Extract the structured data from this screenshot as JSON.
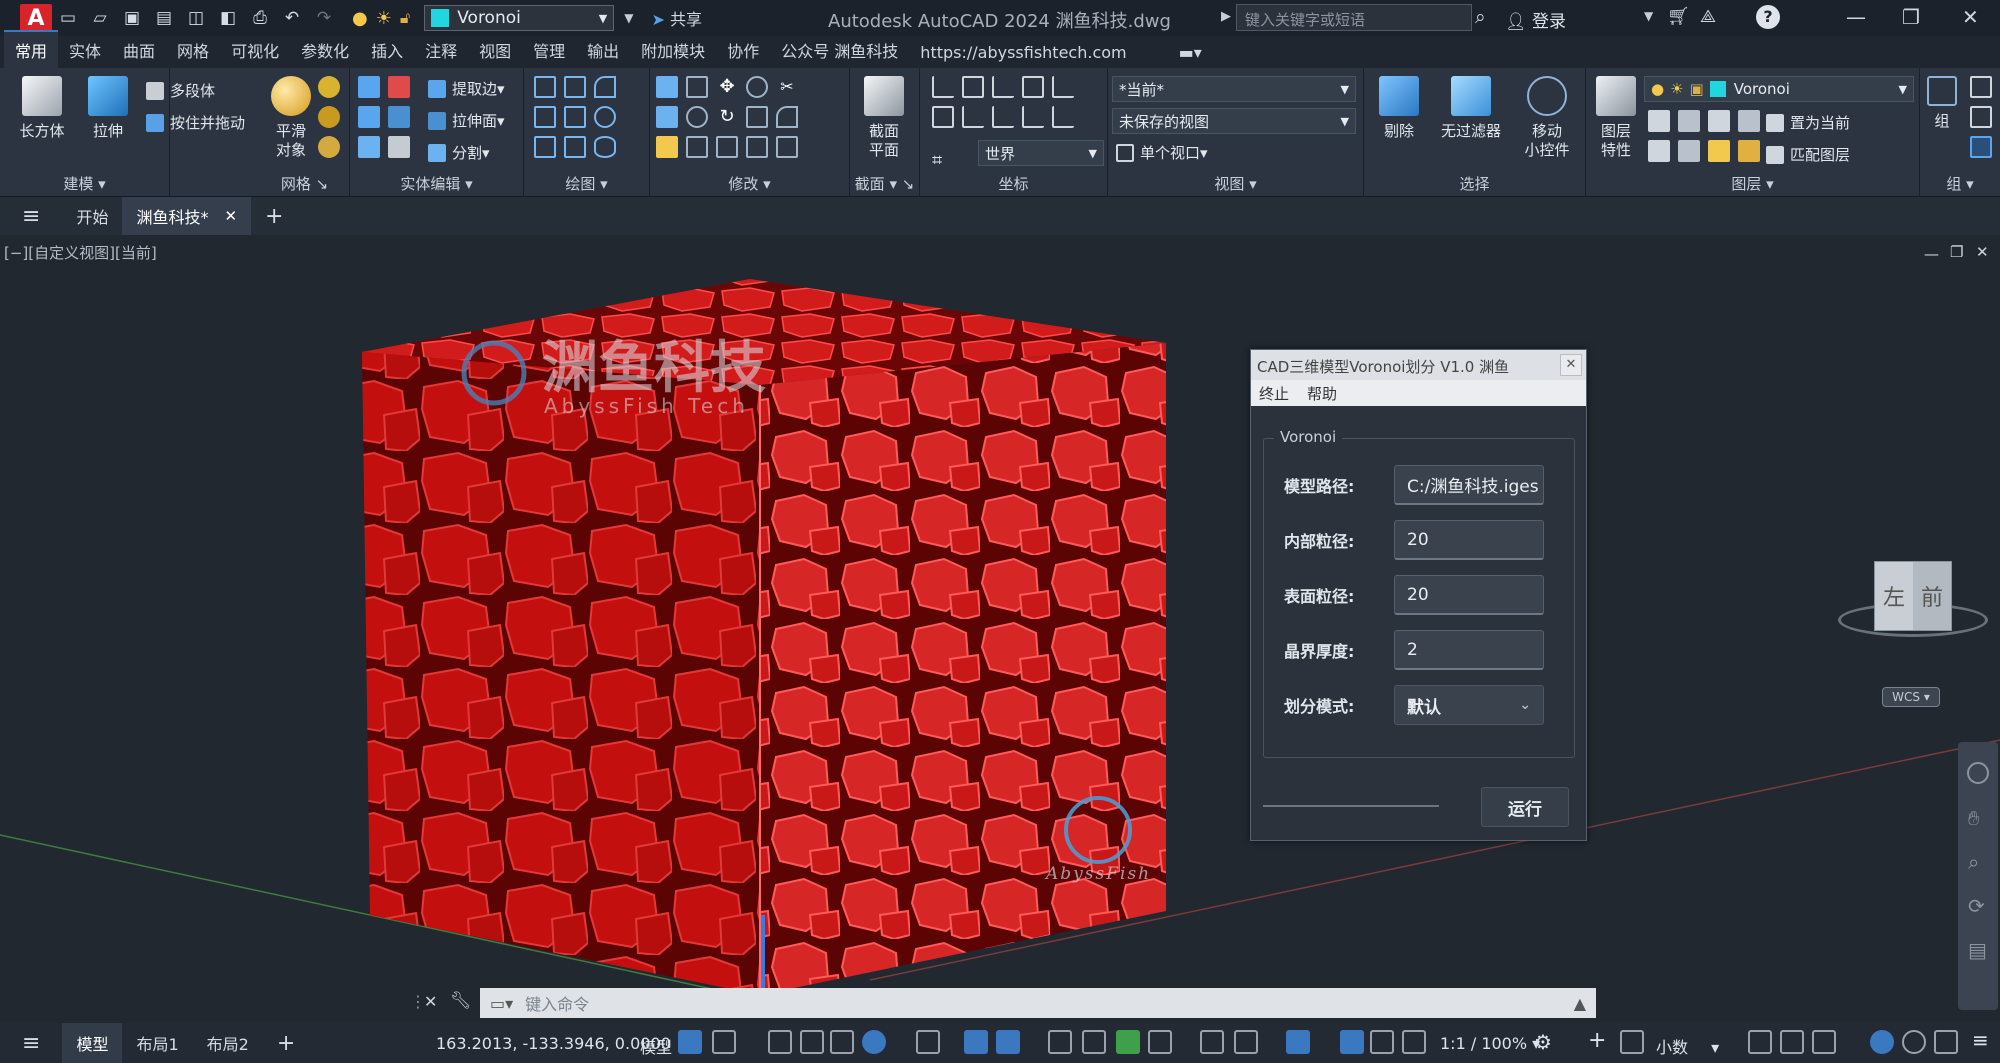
{
  "titlebar": {
    "workspace": "Voronoi",
    "share": "共享",
    "app_title": "Autodesk AutoCAD 2024    渊鱼科技.dwg",
    "search_placeholder": "键入关键字或短语",
    "login": "登录"
  },
  "ribbon_tabs": [
    "常用",
    "实体",
    "曲面",
    "网格",
    "可视化",
    "参数化",
    "插入",
    "注释",
    "视图",
    "管理",
    "输出",
    "附加模块",
    "协作",
    "公众号 渊鱼科技",
    "https://abyssfishtech.com"
  ],
  "ribbon": {
    "panels": {
      "modeling": "建模",
      "mesh": "网格",
      "solid_edit": "实体编辑",
      "draw": "绘图",
      "modify": "修改",
      "section": "截面",
      "coordinates": "坐标",
      "view": "视图",
      "selection": "选择",
      "layers": "图层",
      "groups": "组"
    },
    "box": "长方体",
    "extrude": "拉伸",
    "polysolid": "多段体",
    "presspull": "按住并拖动",
    "smooth": "平滑\n对象",
    "extract_edges": "提取边",
    "extrude_faces": "拉伸面",
    "separate": "分割",
    "section_plane": "截面\n平面",
    "world": "世界",
    "current_view": "*当前*",
    "unsaved_view": "未保存的视图",
    "single_viewport": "单个视口",
    "cull": "剔除",
    "no_filter": "无过滤器",
    "move_gizmo": "移动\n小控件",
    "layer_props": "图层\n特性",
    "layer_current": "Voronoi",
    "set_current": "置为当前",
    "match_layer": "匹配图层",
    "group": "组"
  },
  "doc_tabs": [
    "开始",
    "渊鱼科技*"
  ],
  "viewport": {
    "label": "[−][自定义视图][当前]",
    "watermark_cn": "渊鱼科技",
    "watermark_en": "AbyssFish Tech",
    "watermark_small": "AbyssFish",
    "viewcube_left": "左",
    "viewcube_front": "前",
    "wcs": "WCS"
  },
  "dialog": {
    "title": "CAD三维模型Voronoi划分 V1.0 渊鱼",
    "menu": [
      "终止",
      "帮助"
    ],
    "group_label": "Voronoi",
    "fields": [
      {
        "label": "模型路径:",
        "value": "C:/渊鱼科技.iges"
      },
      {
        "label": "内部粒径:",
        "value": "20"
      },
      {
        "label": "表面粒径:",
        "value": "20"
      },
      {
        "label": "晶界厚度:",
        "value": "2"
      }
    ],
    "mode_label": "划分模式:",
    "mode_value": "默认",
    "run_label": "运行"
  },
  "command": {
    "placeholder": "键入命令"
  },
  "status": {
    "tabs": [
      "模型",
      "布局1",
      "布局2"
    ],
    "coords": "163.2013, -133.3946, 0.0000",
    "model": "模型",
    "scale": "1:1 / 100%",
    "units": "小数"
  },
  "colors": {
    "accent": "#3a78c0",
    "cube_red": "#c90f0f",
    "cube_dark": "#8e0606"
  }
}
